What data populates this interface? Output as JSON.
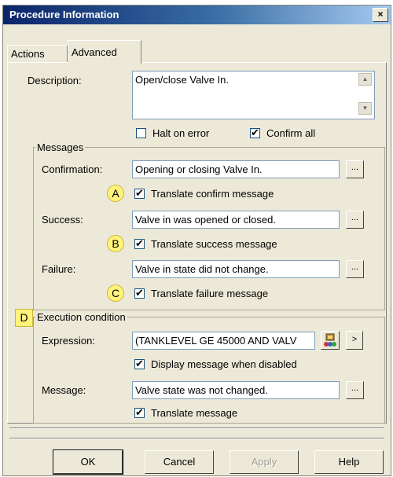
{
  "window": {
    "title": "Procedure Information",
    "close_glyph": "×"
  },
  "tabs": [
    {
      "label": "Actions",
      "active": false
    },
    {
      "label": "Advanced",
      "active": true
    }
  ],
  "description": {
    "label": "Description:",
    "value": "Open/close Valve In."
  },
  "options": {
    "halt_on_error": {
      "label": "Halt on error",
      "checked": false
    },
    "confirm_all": {
      "label": "Confirm all",
      "checked": true
    }
  },
  "messages": {
    "group_label": "Messages",
    "confirmation": {
      "label": "Confirmation:",
      "value": "Opening or closing Valve In.",
      "translate_label": "Translate confirm message",
      "translate_checked": true,
      "callout": "A"
    },
    "success": {
      "label": "Success:",
      "value": "Valve in was opened or closed.",
      "translate_label": "Translate success message",
      "translate_checked": true,
      "callout": "B"
    },
    "failure": {
      "label": "Failure:",
      "value": "Valve in state did not change.",
      "translate_label": "Translate failure message",
      "translate_checked": true,
      "callout": "C"
    }
  },
  "execution": {
    "group_label": "Execution condition",
    "callout": "D",
    "expression": {
      "label": "Expression:",
      "value": "(TANKLEVEL GE 45000 AND VALV"
    },
    "display_when_disabled": {
      "label": "Display message when disabled",
      "checked": true
    },
    "message": {
      "label": "Message:",
      "value": "Valve state was not changed."
    },
    "translate_message": {
      "label": "Translate message",
      "checked": true
    }
  },
  "ellipsis_label": "...",
  "arrow_label": ">",
  "check_glyph": "✔",
  "buttons": {
    "ok": "OK",
    "cancel": "Cancel",
    "apply": "Apply",
    "help": "Help"
  },
  "colors": {
    "title_start": "#0a246a",
    "title_end": "#a6caf0",
    "dialog_bg": "#ece9d8",
    "callout": "#fff37a"
  }
}
